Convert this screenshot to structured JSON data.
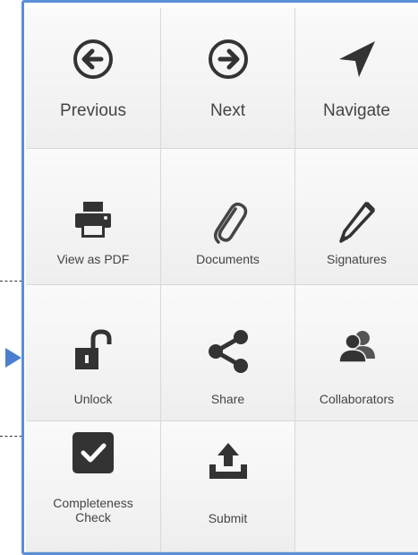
{
  "toolbar": {
    "previous_label": "Previous",
    "next_label": "Next",
    "navigate_label": "Navigate",
    "view_pdf_label": "View as PDF",
    "documents_label": "Documents",
    "signatures_label": "Signatures",
    "unlock_label": "Unlock",
    "share_label": "Share",
    "collaborators_label": "Collaborators",
    "completeness_label_line1": "Completeness",
    "completeness_label_line2": "Check",
    "submit_label": "Submit"
  },
  "icons": {
    "previous": "arrow-left-circle-icon",
    "next": "arrow-right-circle-icon",
    "navigate": "location-arrow-icon",
    "view_pdf": "printer-icon",
    "documents": "paperclip-icon",
    "signatures": "pencil-icon",
    "unlock": "unlock-icon",
    "share": "share-icon",
    "collaborators": "users-icon",
    "completeness": "check-square-icon",
    "submit": "upload-tray-icon"
  },
  "colors": {
    "panel_border": "#5b8fd6",
    "icon": "#333333",
    "label": "#444444",
    "annotation_arrow": "#4a7fd0"
  }
}
